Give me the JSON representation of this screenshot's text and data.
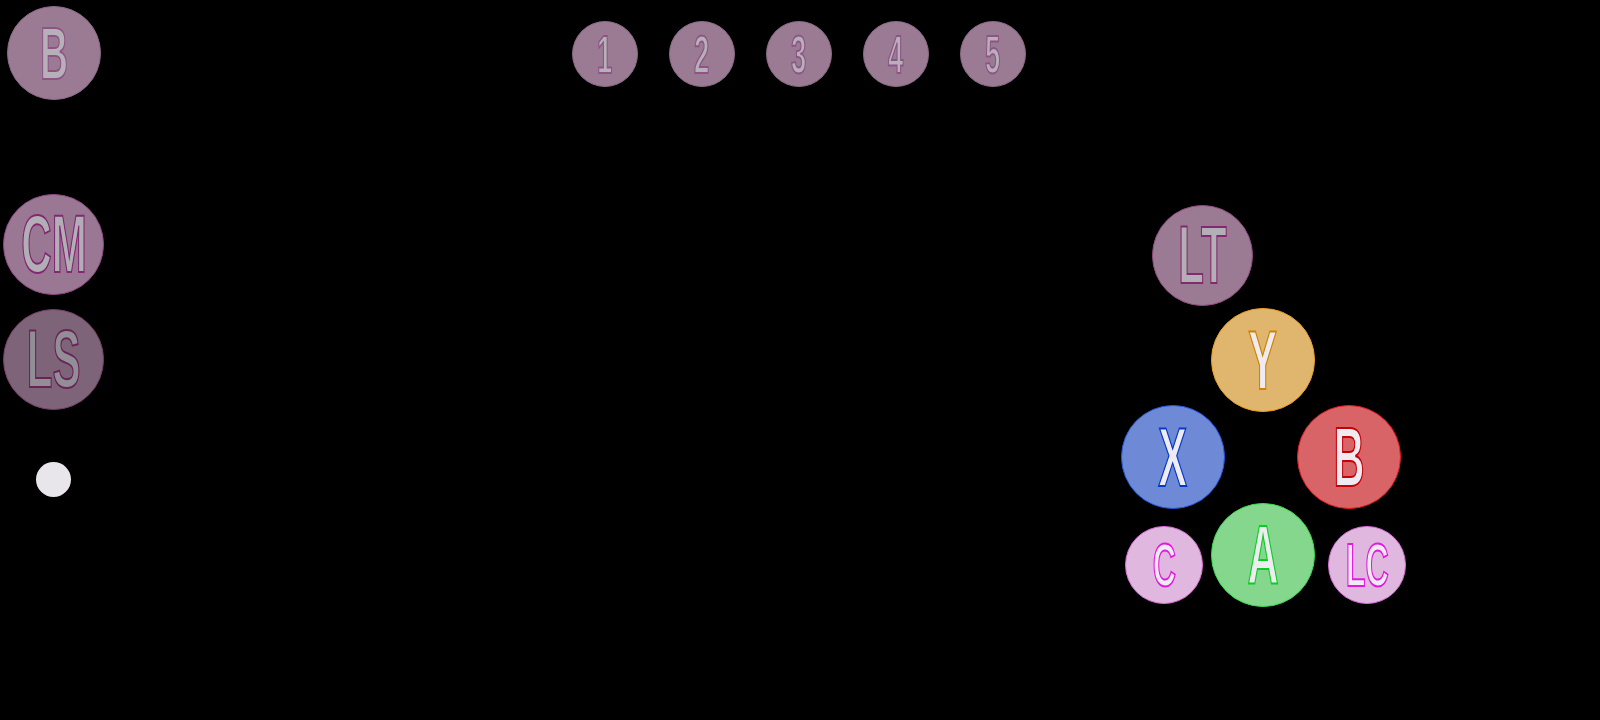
{
  "corner_button": {
    "label": "B"
  },
  "number_buttons": [
    {
      "label": "1"
    },
    {
      "label": "2"
    },
    {
      "label": "3"
    },
    {
      "label": "4"
    },
    {
      "label": "5"
    }
  ],
  "side_buttons": [
    {
      "label": "CM",
      "color": "#9a7894"
    },
    {
      "label": "LS",
      "color": "#7e6478"
    }
  ],
  "face_buttons": [
    {
      "label": "LT",
      "color": "#9b7b93"
    },
    {
      "label": "Y",
      "color": "#e0b66f"
    },
    {
      "label": "X",
      "color": "#6e8ad6"
    },
    {
      "label": "B",
      "color": "#d96468"
    },
    {
      "label": "C",
      "color": "#e0b8df"
    },
    {
      "label": "A",
      "color": "#85d78e"
    },
    {
      "label": "LC",
      "color": "#e0b8df"
    }
  ]
}
